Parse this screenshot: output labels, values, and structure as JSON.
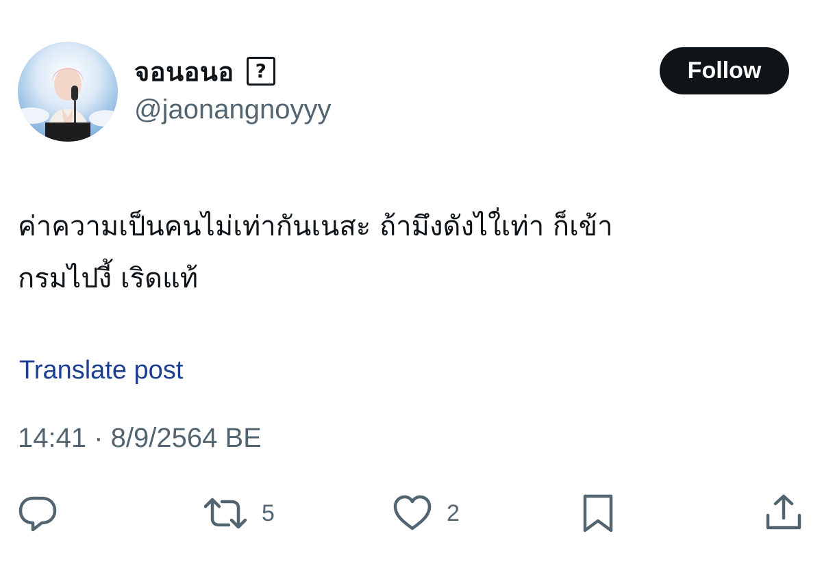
{
  "author": {
    "display_name": "จอนอนอ",
    "badge_glyph": "?",
    "handle": "@jaonangnoyyy",
    "avatar_icon": "avatar-photo"
  },
  "follow_label": "Follow",
  "post": {
    "text_lines": [
      "ค่าความเป็นคนไม่เท่ากันเนสะ ถ้ามึงดังไใ่เท่า ก็เข้า",
      "กรมไปงี้ เริดแท้"
    ],
    "translate_label": "Translate post",
    "timestamp": "14:41 · 8/9/2564 BE"
  },
  "actions": {
    "reply": {
      "icon": "reply-icon",
      "count": ""
    },
    "repost": {
      "icon": "repost-icon",
      "count": "5"
    },
    "like": {
      "icon": "heart-icon",
      "count": "2"
    },
    "bookmark": {
      "icon": "bookmark-icon",
      "count": ""
    },
    "share": {
      "icon": "share-icon",
      "count": ""
    }
  },
  "colors": {
    "text_primary": "#0f1419",
    "text_secondary": "#536471",
    "link": "#1d3f8f",
    "follow_bg": "#0f1419",
    "follow_text": "#ffffff"
  }
}
